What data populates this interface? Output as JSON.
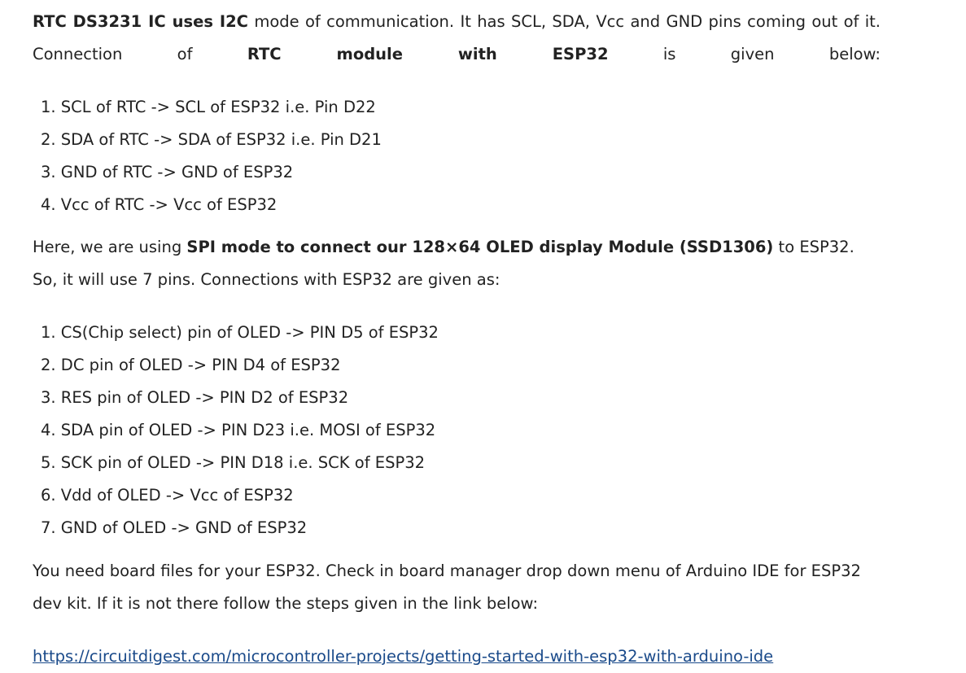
{
  "intro": {
    "part1_bold": "RTC DS3231 IC uses I2C",
    "part2": " mode of communication. It has SCL, SDA, Vcc and GND pins coming out of it. Connection of ",
    "part3_bold": "RTC module with ESP32",
    "part4": " is given below:"
  },
  "rtc_connections": [
    "1. SCL of RTC -> SCL of ESP32 i.e. Pin D22",
    "2. SDA of RTC -> SDA of ESP32 i.e. Pin D21",
    "3. GND of RTC -> GND of ESP32",
    "4. Vcc of RTC -> Vcc of ESP32"
  ],
  "oled_intro": {
    "part1": "Here, we are using ",
    "part2_bold": "SPI mode to connect our 128×64 OLED display Module (SSD1306)",
    "part3": " to ESP32. So, it will use 7 pins. Connections with ESP32 are given as:"
  },
  "oled_connections": [
    "1. CS(Chip select) pin of OLED -> PIN D5 of ESP32",
    "2. DC pin of OLED -> PIN D4 of ESP32",
    "3. RES pin of OLED -> PIN D2 of ESP32",
    "4. SDA pin of OLED -> PIN D23 i.e. MOSI of ESP32",
    "5. SCK pin of OLED -> PIN D18 i.e. SCK of ESP32",
    "6. Vdd of OLED -> Vcc of ESP32",
    "7. GND of OLED -> GND of ESP32"
  ],
  "board_note": "You need board files for your ESP32. Check in board manager drop down menu of Arduino IDE for ESP32 dev kit. If it is not there follow the steps given in the link below:",
  "link": {
    "text": "https://circuitdigest.com/microcontroller-projects/getting-started-with-esp32-with-arduino-ide",
    "href": "#"
  },
  "colors": {
    "text": "#222222",
    "link": "#1a4a8a"
  }
}
